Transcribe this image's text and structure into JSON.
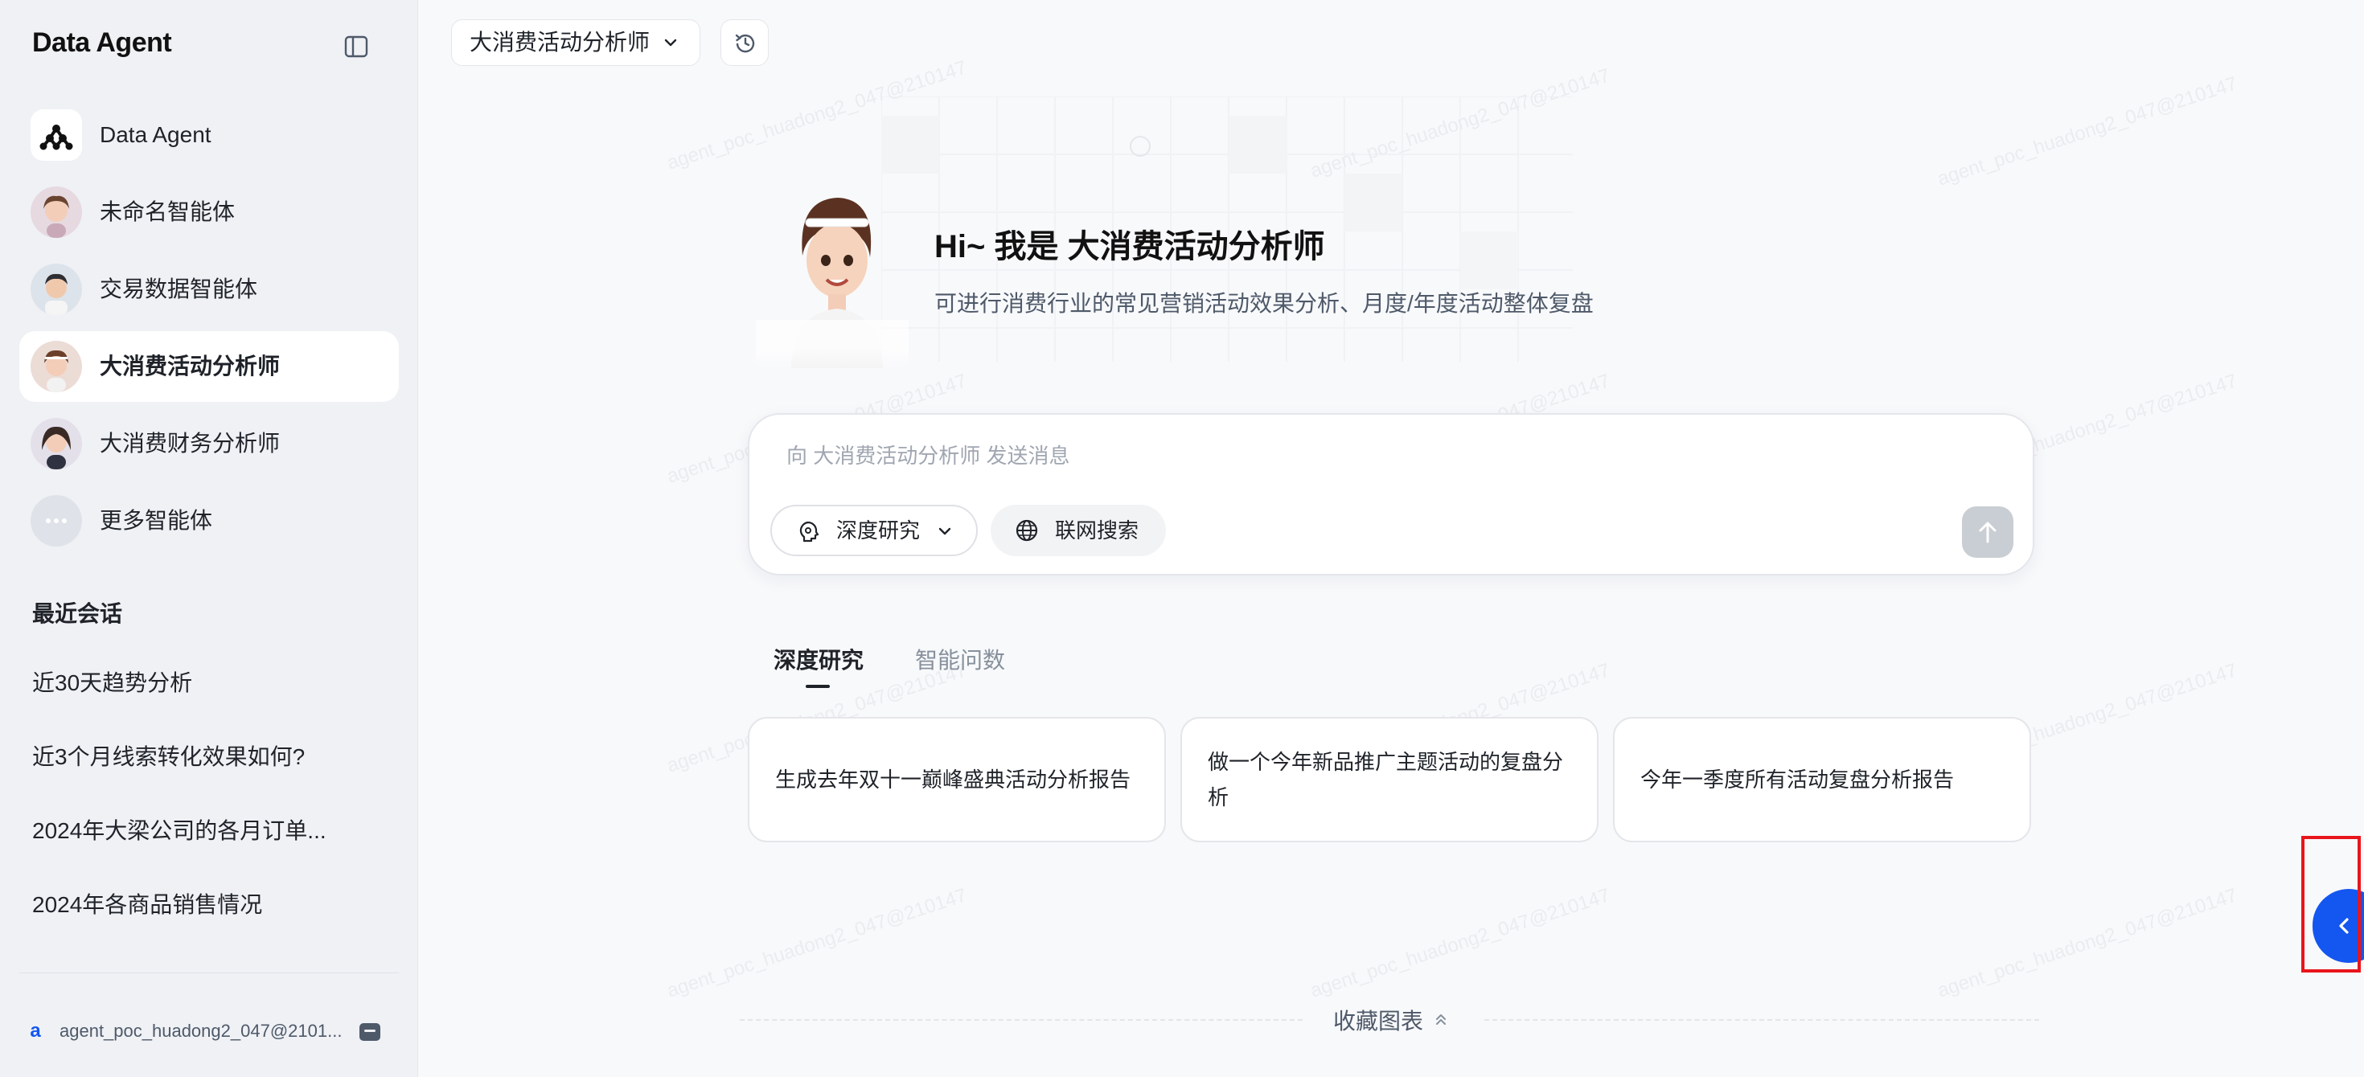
{
  "sidebar": {
    "brand": "Data Agent",
    "agents": [
      {
        "label": "Data Agent"
      },
      {
        "label": "未命名智能体"
      },
      {
        "label": "交易数据智能体"
      },
      {
        "label": "大消费活动分析师"
      },
      {
        "label": "大消费财务分析师"
      },
      {
        "label": "更多智能体"
      }
    ],
    "active_agent_index": 3,
    "recent_title": "最近会话",
    "recent": [
      "近30天趋势分析",
      "近3个月线索转化效果如何?",
      "2024年大梁公司的各月订单...",
      "2024年各商品销售情况"
    ],
    "user": {
      "badge": "a",
      "name": "agent_poc_huadong2_047@2101..."
    }
  },
  "header": {
    "agent_select_label": "大消费活动分析师"
  },
  "hero": {
    "title": "Hi~ 我是 大消费活动分析师",
    "description": "可进行消费行业的常见营销活动效果分析、月度/年度活动整体复盘"
  },
  "composer": {
    "placeholder": "向 大消费活动分析师 发送消息",
    "value": "",
    "deep_research_label": "深度研究",
    "web_search_label": "联网搜索"
  },
  "tabs": [
    {
      "label": "深度研究",
      "active": true
    },
    {
      "label": "智能问数",
      "active": false
    }
  ],
  "suggestions": [
    "生成去年双十一巅峰盛典活动分析报告",
    "做一个今年新品推广主题活动的复盘分析",
    "今年一季度所有活动复盘分析报告"
  ],
  "favorites_label": "收藏图表",
  "watermark_text": "agent_poc_huadong2_047@210147",
  "colors": {
    "accent": "#1456f0",
    "sidebar_bg": "#eff1f5",
    "highlight": "#e8151b"
  },
  "icons": {
    "collapse": "sidebar-toggle-icon",
    "history": "history-icon",
    "deep_research": "brain-icon",
    "web_search": "globe-icon",
    "send": "arrow-up-icon",
    "float": "chevron-left-icon"
  }
}
